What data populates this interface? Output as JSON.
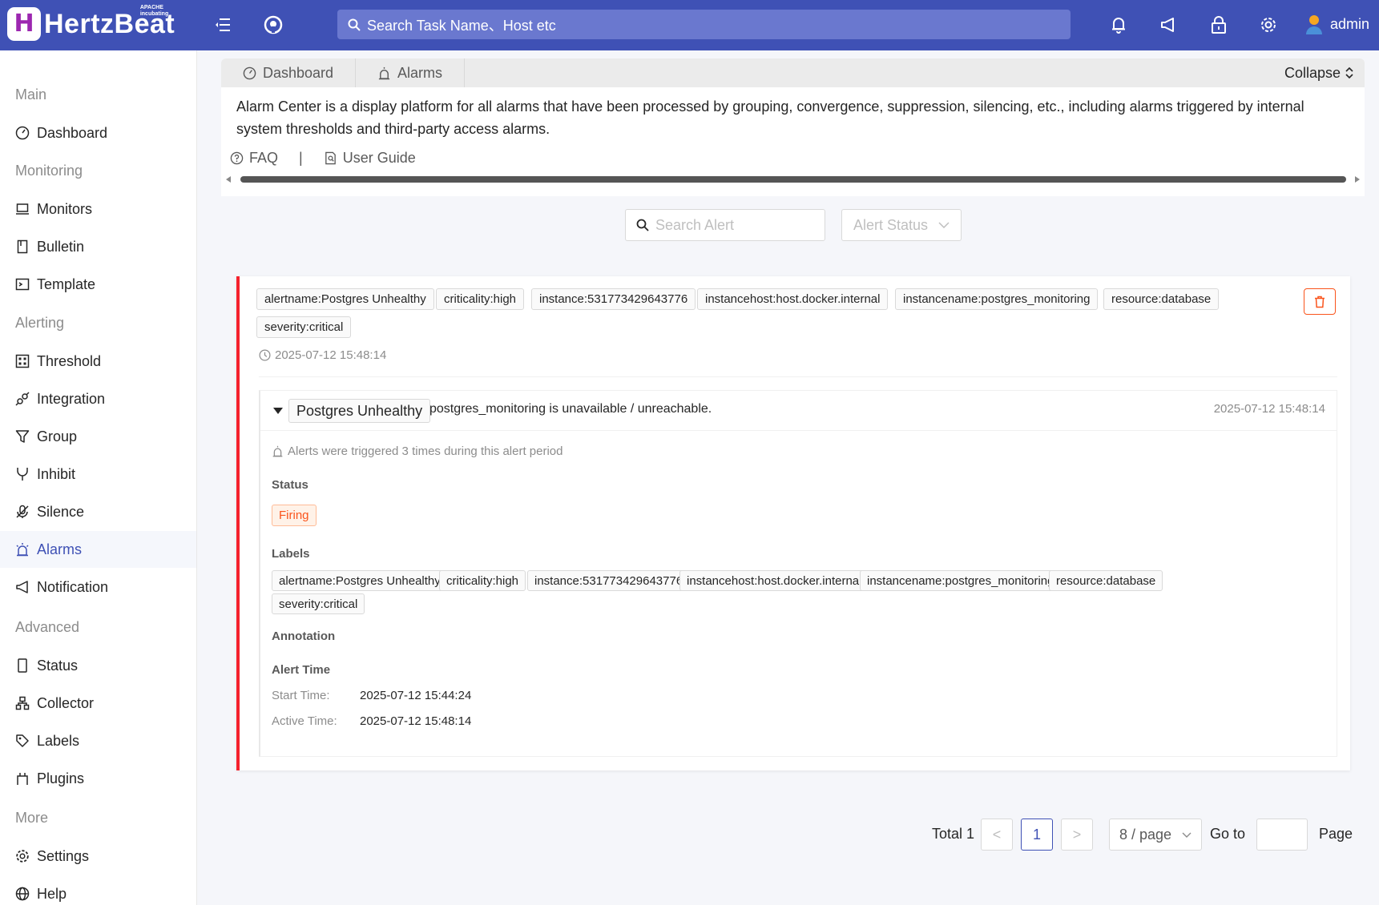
{
  "header": {
    "logo_mark": "H",
    "logo_text": "HertzBeat",
    "logo_sup_1": "APACHE",
    "logo_sup_2": "incubating",
    "search_placeholder": "Search Task Name、Host etc",
    "user_name": "admin"
  },
  "sidebar": {
    "groups": [
      "Main",
      "Monitoring",
      "Alerting",
      "Advanced",
      "More"
    ],
    "items": [
      {
        "label": "Dashboard",
        "icon": "dashboard-icon"
      },
      {
        "label": "Monitors",
        "icon": "laptop-icon"
      },
      {
        "label": "Bulletin",
        "icon": "book-icon"
      },
      {
        "label": "Template",
        "icon": "code-icon"
      },
      {
        "label": "Threshold",
        "icon": "calculator-icon"
      },
      {
        "label": "Integration",
        "icon": "api-icon"
      },
      {
        "label": "Group",
        "icon": "filter-icon"
      },
      {
        "label": "Inhibit",
        "icon": "fork-icon"
      },
      {
        "label": "Silence",
        "icon": "mute-icon"
      },
      {
        "label": "Alarms",
        "icon": "alarm-icon"
      },
      {
        "label": "Notification",
        "icon": "sound-icon"
      },
      {
        "label": "Status",
        "icon": "mobile-icon"
      },
      {
        "label": "Collector",
        "icon": "cluster-icon"
      },
      {
        "label": "Labels",
        "icon": "tag-icon"
      },
      {
        "label": "Plugins",
        "icon": "plugin-icon"
      },
      {
        "label": "Settings",
        "icon": "gear-icon"
      },
      {
        "label": "Help",
        "icon": "globe-icon"
      }
    ],
    "active": "Alarms"
  },
  "info_panel": {
    "tabs": [
      "Dashboard",
      "Alarms"
    ],
    "collapse_label": "Collapse",
    "description": "Alarm Center is a display platform for all alarms that have been processed by grouping, convergence, suppression, silencing, etc., including alarms triggered by internal system thresholds and third-party access alarms.",
    "faq_label": "FAQ",
    "separator": "|",
    "guide_label": "User Guide"
  },
  "filters": {
    "search_placeholder": "Search Alert",
    "status_placeholder": "Alert Status"
  },
  "alert": {
    "labels": [
      "alertname:Postgres Unhealthy",
      "criticality:high",
      "instance:531773429643776",
      "instancehost:host.docker.internal",
      "instancename:postgres_monitoring",
      "resource:database",
      "severity:critical"
    ],
    "time": "2025-07-12 15:48:14",
    "detail": {
      "name": "Postgres Unhealthy",
      "message": "postgres_monitoring is unavailable / unreachable.",
      "time": "2025-07-12 15:48:14",
      "trigger_note": "Alerts were triggered 3 times during this alert period",
      "status_title": "Status",
      "status_value": "Firing",
      "labels_title": "Labels",
      "annotation_title": "Annotation",
      "alert_time_title": "Alert Time",
      "start_time_label": "Start Time:",
      "start_time_value": "2025-07-12 15:44:24",
      "active_time_label": "Active Time:",
      "active_time_value": "2025-07-12 15:48:14"
    }
  },
  "pagination": {
    "total_label": "Total 1",
    "prev": "<",
    "current": "1",
    "next": ">",
    "page_size": "8 / page",
    "goto_label": "Go to",
    "page_label": "Page"
  },
  "colors": {
    "header_bg": "#3f51b5",
    "accent": "#3f51b5",
    "alert_bar": "#f5222d",
    "firing": "#fa541c"
  }
}
